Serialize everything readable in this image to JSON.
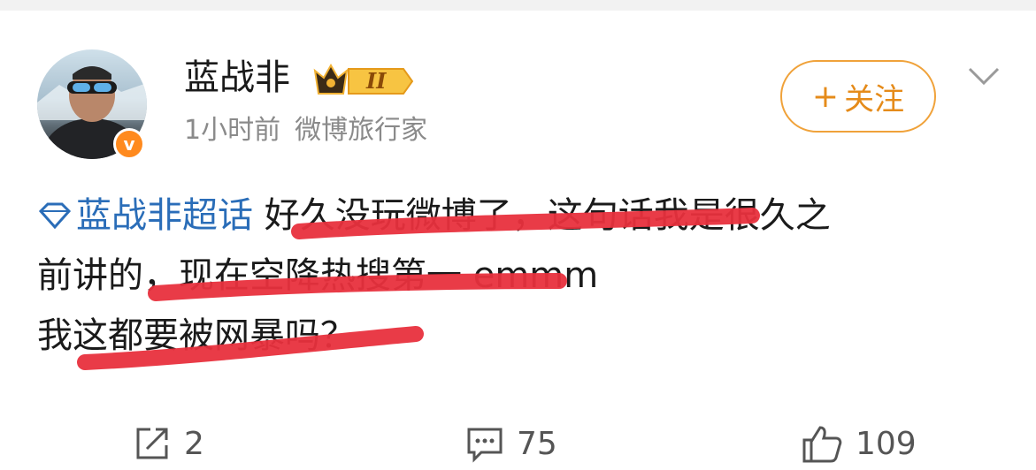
{
  "user": {
    "name": "蓝战非",
    "level": "II",
    "time": "1小时前",
    "tag": "微博旅行家"
  },
  "follow_label": "关注",
  "post": {
    "topic": "蓝战非超话",
    "line1_rest": "好久没玩微博了，这句话我是很久之",
    "line2": "前讲的，现在空降热搜第一   emmm",
    "line3": "我这都要被网暴吗？"
  },
  "actions": {
    "share_count": "2",
    "comment_count": "75",
    "like_count": "109"
  },
  "colors": {
    "accent_orange": "#f0a23a",
    "topic_blue": "#2a6db8",
    "underline_red": "#e8303d"
  },
  "icons": [
    "diamond-icon",
    "crown-icon",
    "chevron-down-icon",
    "share-icon",
    "comment-icon",
    "like-icon",
    "verified-icon"
  ]
}
